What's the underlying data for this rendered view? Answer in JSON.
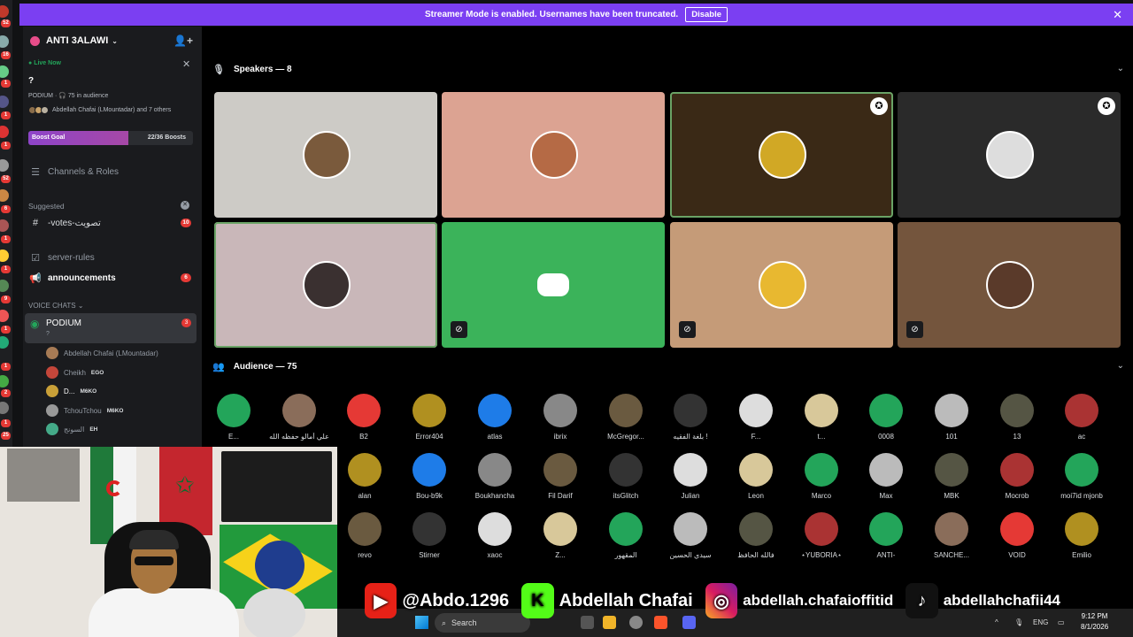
{
  "banner": {
    "text": "Streamer Mode is enabled. Usernames have been truncated.",
    "button": "Disable"
  },
  "guild_badges": [
    "52",
    "16",
    "1",
    "1",
    "1",
    "52",
    "6",
    "1",
    "1",
    "9",
    "1",
    "1",
    "2",
    "1",
    "1",
    "1",
    "25"
  ],
  "server": {
    "name": "ANTI 3ALAWI"
  },
  "live": {
    "label": "Live Now",
    "title": "?",
    "info": "PODIUM · 🎧 75 in audience",
    "users": "Abdellah Chafai (LMountadar) and 7 others"
  },
  "boost": {
    "label": "Boost Goal",
    "value": "22/36 Boosts",
    "fraction": 0.61
  },
  "channels": {
    "channels_roles": "Channels & Roles",
    "suggested": "Suggested",
    "votes": {
      "name": "-votes-تصويت",
      "count": "10"
    },
    "server_rules": "server-rules",
    "announcements": {
      "name": "announcements",
      "count": "6"
    },
    "voice_header": "VOICE CHATS",
    "podium": {
      "name": "PODIUM",
      "sub": "?",
      "count": "3"
    }
  },
  "voice_users": [
    {
      "name": "Abdellah Chafai (LMountadar)",
      "tag": ""
    },
    {
      "name": "Cheikh",
      "tag": "EGO"
    },
    {
      "name": "D...",
      "tag": "M6KO"
    },
    {
      "name": "TchouTchou",
      "tag": "M6KO"
    },
    {
      "name": "السونج",
      "tag": "EH"
    }
  ],
  "stage": {
    "speakers": "Speakers — 8",
    "audience": "Audience — 75"
  },
  "audience": [
    [
      "E...",
      "علي أمالو حفظه الله",
      "B2",
      "Error404",
      "atlas",
      "ibrix",
      "McGregor...",
      "بلغة الفقيه !",
      "F...",
      "t...",
      "0008",
      "101",
      "13",
      "ac"
    ],
    [
      "alan",
      "Bou-b9k",
      "Boukhancha",
      "Fil Darif",
      "itsGlitch",
      "Julian",
      "Leon",
      "Marco",
      "Max",
      "MBK",
      "Mocrob",
      "moi7id mjonb"
    ],
    [
      "revo",
      "Stirner",
      "xaoc",
      "Z...",
      "المقهور",
      "سيدي الحسين",
      "فالله الحافظ",
      "⋆YUBORIA⋆",
      "ANTI-",
      "SANCHE...",
      "VOID",
      "Emilio"
    ]
  ],
  "social": {
    "youtube": "@Abdo.1296",
    "kick": "Abdellah Chafai",
    "instagram": "abdellah.chafaioffitid",
    "tiktok": "abdellahchafii44"
  },
  "taskbar": {
    "search": "Search",
    "lang": "ENG",
    "time": "9:12 PM",
    "date": "8/1/2026"
  },
  "colors": {
    "accent": "#7b3ff2",
    "green": "#23a55a",
    "red": "#e53935"
  }
}
